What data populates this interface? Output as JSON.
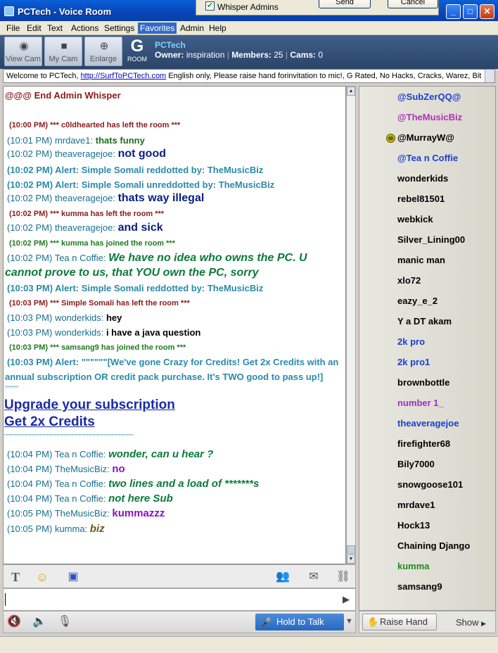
{
  "window": {
    "title": "PCTech - Voice Room"
  },
  "popup": {
    "checkbox_label": "Whisper Admins",
    "send_label": "Send",
    "cancel_label": "Cancel"
  },
  "menu": [
    "File",
    "Edit",
    "Text",
    "Actions",
    "Settings",
    "Favorites",
    "Admin",
    "Help"
  ],
  "toolbar": {
    "view_cam": "View Cam",
    "my_cam": "My Cam",
    "enlarge": "Enlarge",
    "rating": "G",
    "rating_label": "ROOM",
    "room_name": "PCTech",
    "owner_label": "Owner:",
    "owner": "inspiration",
    "members_label": "Members:",
    "members": "25",
    "cams_label": "Cams:",
    "cams": "0"
  },
  "welcome": {
    "prefix": "Welcome to PCTech, ",
    "link": "http://SurfToPCTech.com",
    "suffix": " English only, Please raise hand forinvitation to mic!, G Rated, No Hacks, Cracks, Warez, Bit"
  },
  "chat": {
    "m0": {
      "text": "@@@ End Admin Whisper"
    },
    "m1": {
      "ts": "(10:00 PM)",
      "text": "*** c0ldhearted has left the room ***"
    },
    "m2": {
      "ts": "(10:01 PM)",
      "nick": "mrdave1:",
      "text": "thats funny"
    },
    "m3": {
      "ts": "(10:02 PM)",
      "nick": "theaveragejoe:",
      "text": "not good"
    },
    "m4": {
      "ts": "(10:02 PM)",
      "text": "Alert: Simple Somali reddotted by: TheMusicBiz"
    },
    "m5": {
      "ts": "(10:02 PM)",
      "text": "Alert: Simple Somali unreddotted by: TheMusicBiz"
    },
    "m6": {
      "ts": "(10:02 PM)",
      "nick": "theaveragejoe:",
      "text": "thats way illegal"
    },
    "m7": {
      "ts": "(10:02 PM)",
      "text": "*** kumma has left the room ***"
    },
    "m8": {
      "ts": "(10:02 PM)",
      "nick": "theaveragejoe:",
      "text": "and sick"
    },
    "m9": {
      "ts": "(10:02 PM)",
      "text": "*** kumma has joined the room ***"
    },
    "m10": {
      "ts": "(10:02 PM)",
      "nick": "Tea n Coffie:",
      "text": "We have no idea who owns the PC. U",
      "text2": "cannot prove to us, that YOU own the PC, sorry"
    },
    "m11": {
      "ts": "(10:03 PM)",
      "text": "Alert: Simple Somali reddotted by: TheMusicBiz"
    },
    "m12": {
      "ts": "(10:03 PM)",
      "text": "*** Simple Somali has left the room ***"
    },
    "m13": {
      "ts": "(10:03 PM)",
      "nick": "wonderkids:",
      "text": "hey"
    },
    "m14": {
      "ts": "(10:03 PM)",
      "nick": "wonderkids:",
      "text": "i have a java question"
    },
    "m15": {
      "ts": "(10:03 PM)",
      "text": "*** samsang9 has joined the room ***"
    },
    "m16": {
      "ts": "(10:03 PM)",
      "text": "Alert: \"\"\"\"\"\"[We've gone Crazy for Credits! Get 2x Credits with an",
      "text2": "annual subscription OR credit pack purchase. It's TWO good to pass up!]",
      "text3": "\"\"\"\"\"\""
    },
    "m17": {
      "link1": "Upgrade your subscription",
      "link2": "Get 2x Credits",
      "text": "\"\"\"\"\"\"\"\"\"\"\"\"\"\"\"\"\"\"\"\"\"\"\"\"\"\"\"\"\"\"\"\"\"\"\"\"\"\"\"\"\"\"\"\"\"\"\"\"\"\"\"\"\"\"\"\"\"\"\"\"\"\"\"\"\"\"\"\"\"\"\"\"\"\""
    },
    "m18": {
      "ts": "(10:04 PM)",
      "nick": "Tea n Coffie:",
      "text": "wonder, can u hear ?"
    },
    "m19": {
      "ts": "(10:04 PM)",
      "nick": "TheMusicBiz:",
      "text": "no"
    },
    "m20": {
      "ts": "(10:04 PM)",
      "nick": "Tea n Coffie:",
      "text": "two lines and a load of  *******s"
    },
    "m21": {
      "ts": "(10:04 PM)",
      "nick": "Tea n Coffie:",
      "text": "not here Sub"
    },
    "m22": {
      "ts": "(10:05 PM)",
      "nick": "TheMusicBiz:",
      "text": "kummazzz"
    },
    "m23": {
      "ts": "(10:05 PM)",
      "nick": "kumma:",
      "text": "biz"
    }
  },
  "bottom": {
    "hold_to_talk": "Hold to Talk",
    "raise_hand": "Raise Hand",
    "show": "Show"
  },
  "users": [
    {
      "name": "@SubZerQQ@",
      "color": "#1a3fd0"
    },
    {
      "name": "@TheMusicBiz",
      "color": "#b030b8"
    },
    {
      "name": "@MurrayW@",
      "color": "#000000"
    },
    {
      "name": "@Tea n Coffie",
      "color": "#1a3fd0"
    },
    {
      "name": "wonderkids",
      "color": "#000000"
    },
    {
      "name": "rebel81501",
      "color": "#000000"
    },
    {
      "name": "webkick",
      "color": "#000000"
    },
    {
      "name": "Silver_Lining00",
      "color": "#000000"
    },
    {
      "name": "manic man",
      "color": "#000000"
    },
    {
      "name": "xlo72",
      "color": "#000000"
    },
    {
      "name": "eazy_e_2",
      "color": "#000000"
    },
    {
      "name": "Y a DT akam",
      "color": "#000000"
    },
    {
      "name": "2k pro",
      "color": "#1a3fd0"
    },
    {
      "name": "2k pro1",
      "color": "#1a3fd0"
    },
    {
      "name": "brownbottle",
      "color": "#000000"
    },
    {
      "name": "number 1_",
      "color": "#9b30c8"
    },
    {
      "name": "theaveragejoe",
      "color": "#1a3fd0"
    },
    {
      "name": "firefighter68",
      "color": "#000000"
    },
    {
      "name": "Bily7000",
      "color": "#000000"
    },
    {
      "name": "snowgoose101",
      "color": "#000000"
    },
    {
      "name": "mrdave1",
      "color": "#000000"
    },
    {
      "name": "Hock13",
      "color": "#000000"
    },
    {
      "name": "Chaining Django",
      "color": "#000000"
    },
    {
      "name": "kumma",
      "color": "#1e8a1e"
    },
    {
      "name": "samsang9",
      "color": "#000000"
    }
  ],
  "colors": {
    "system_red": "#8b1a1a",
    "alert_teal": "#2a8aa8",
    "join_green": "#1e7a1e",
    "nick_blue": "#0b2080",
    "tea_green": "#0b7a3a",
    "musicbiz_purple": "#8a10c8"
  }
}
